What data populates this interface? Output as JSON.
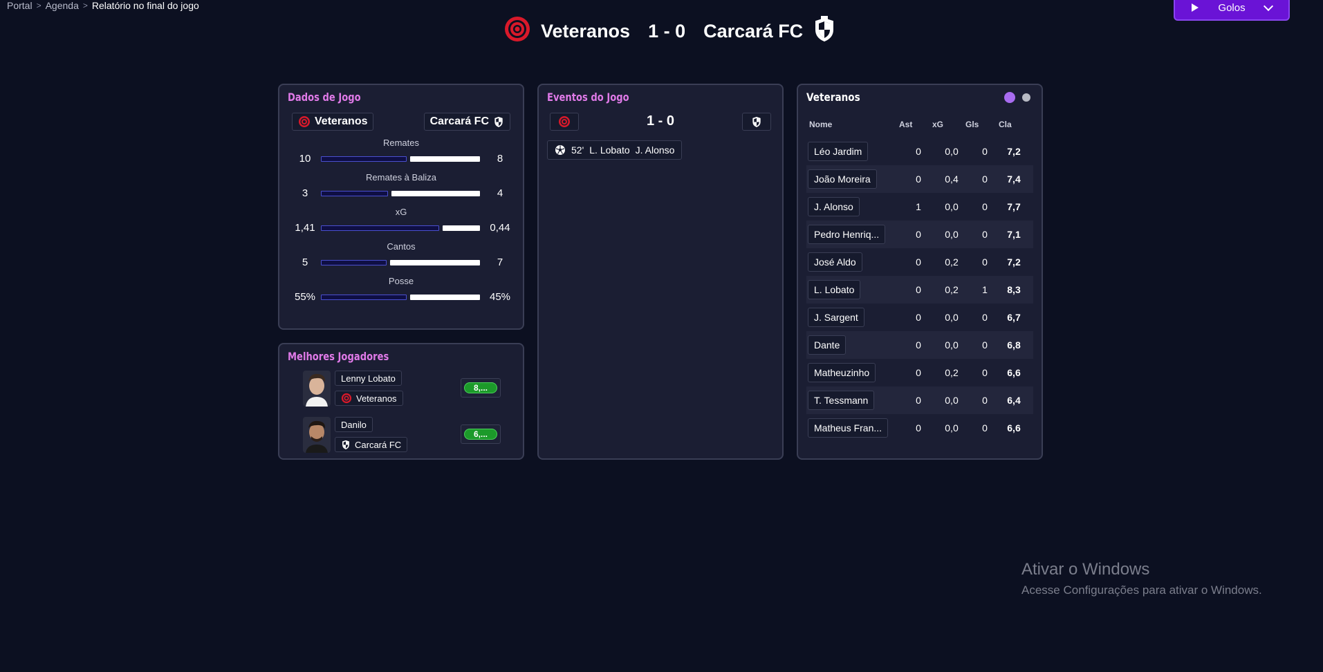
{
  "breadcrumb": {
    "items": [
      "Portal",
      "Agenda"
    ],
    "current": "Relatório no final do jogo"
  },
  "golos_button": {
    "label": "Golos"
  },
  "match": {
    "home": "Veteranos",
    "away": "Carcará FC",
    "score": "1 - 0"
  },
  "dados": {
    "title": "Dados de Jogo",
    "home": "Veteranos",
    "away": "Carcará FC",
    "stats": [
      {
        "label": "Remates",
        "home": "10",
        "away": "8",
        "home_share": 0.55
      },
      {
        "label": "Remates à Baliza",
        "home": "3",
        "away": "4",
        "home_share": 0.43
      },
      {
        "label": "xG",
        "home": "1,41",
        "away": "0,44",
        "home_share": 0.76
      },
      {
        "label": "Cantos",
        "home": "5",
        "away": "7",
        "home_share": 0.42
      },
      {
        "label": "Posse",
        "home": "55%",
        "away": "45%",
        "home_share": 0.55
      }
    ]
  },
  "melhores": {
    "title": "Melhores Jogadores",
    "players": [
      {
        "name": "Lenny Lobato",
        "team": "Veteranos",
        "rating": "8,..."
      },
      {
        "name": "Danilo",
        "team": "Carcará FC",
        "rating": "6,..."
      }
    ]
  },
  "eventos": {
    "title": "Eventos do Jogo",
    "score": "1 - 0",
    "events": [
      {
        "minute": "52'",
        "scorer": "L. Lobato",
        "assist": "J. Alonso"
      }
    ]
  },
  "roster": {
    "title": "Veteranos",
    "headers": {
      "name": "Nome",
      "ast": "Ast",
      "xg": "xG",
      "gls": "Gls",
      "cla": "Cla"
    },
    "players": [
      {
        "name": "Léo Jardim",
        "ast": "0",
        "xg": "0,0",
        "gls": "0",
        "cla": "7,2"
      },
      {
        "name": "João Moreira",
        "ast": "0",
        "xg": "0,4",
        "gls": "0",
        "cla": "7,4"
      },
      {
        "name": "J. Alonso",
        "ast": "1",
        "xg": "0,0",
        "gls": "0",
        "cla": "7,7"
      },
      {
        "name": "Pedro Henriq...",
        "ast": "0",
        "xg": "0,0",
        "gls": "0",
        "cla": "7,1"
      },
      {
        "name": "José Aldo",
        "ast": "0",
        "xg": "0,2",
        "gls": "0",
        "cla": "7,2"
      },
      {
        "name": "L. Lobato",
        "ast": "0",
        "xg": "0,2",
        "gls": "1",
        "cla": "8,3"
      },
      {
        "name": "J. Sargent",
        "ast": "0",
        "xg": "0,0",
        "gls": "0",
        "cla": "6,7"
      },
      {
        "name": "Dante",
        "ast": "0",
        "xg": "0,0",
        "gls": "0",
        "cla": "6,8"
      },
      {
        "name": "Matheuzinho",
        "ast": "0",
        "xg": "0,2",
        "gls": "0",
        "cla": "6,6"
      },
      {
        "name": "T. Tessmann",
        "ast": "0",
        "xg": "0,0",
        "gls": "0",
        "cla": "6,4"
      },
      {
        "name": "Matheus Fran...",
        "ast": "0",
        "xg": "0,0",
        "gls": "0",
        "cla": "6,6"
      }
    ]
  },
  "watermark": {
    "line1": "Ativar o Windows",
    "line2": "Acesse Configurações para ativar o Windows."
  },
  "colors": {
    "accent": "#e07ae8",
    "brand_purple": "#6a13d6",
    "home_red": "#d9192a",
    "rating_green": "#1c9a2a",
    "dot_active": "#a86cf0",
    "dot_inactive": "#b8bac4"
  },
  "icons": {
    "home_crest": "target-crest-icon",
    "away_crest": "shield-crest-icon",
    "goal": "soccer-ball-icon",
    "play": "play-icon",
    "dropdown": "chevron-down-icon"
  }
}
